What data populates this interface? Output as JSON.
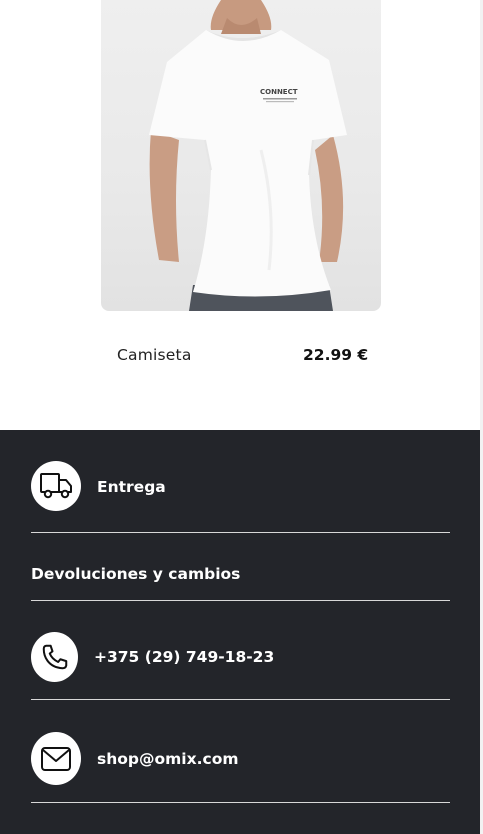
{
  "product": {
    "image_alt": "White t-shirt with CONNECT print",
    "print_text": "CONNECT",
    "name": "Camiseta",
    "price": "22.99 €"
  },
  "footer": {
    "delivery_label": "Entrega",
    "returns_label": "Devoluciones y cambios",
    "phone_label": "+375 (29) 749-18-23",
    "email_label": "shop@omix.com",
    "icons": [
      "truck-icon",
      "phone-icon",
      "mail-icon"
    ]
  }
}
